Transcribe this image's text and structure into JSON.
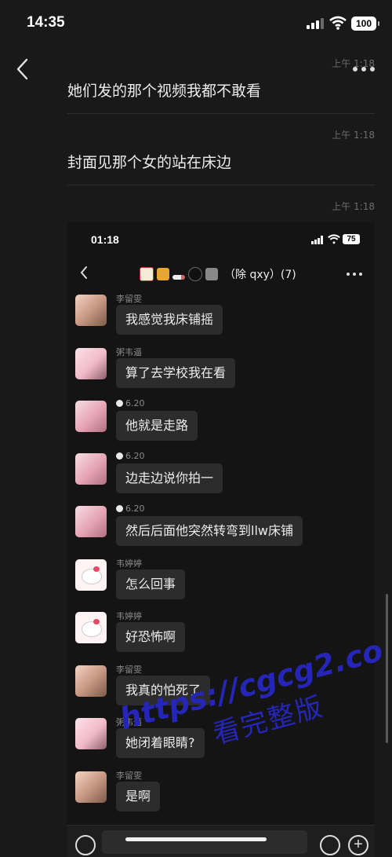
{
  "status_bar": {
    "time": "14:35",
    "battery": "100"
  },
  "messages": [
    {
      "timestamp": "上午 1:18",
      "text": "她们发的那个视频我都不敢看"
    },
    {
      "timestamp": "上午 1:18",
      "text": "封面见那个女的站在床边"
    },
    {
      "timestamp": "上午 1:18",
      "text": ""
    }
  ],
  "screenshot": {
    "status_bar": {
      "time": "01:18",
      "battery": "75"
    },
    "group_title": "（除 qxy）(7)",
    "title_emojis": [
      "mahjong-tile",
      "beer",
      "cigarette",
      "8-ball",
      "camera"
    ],
    "chat": [
      {
        "sender": "李留雯",
        "text": "我感觉我床铺摇",
        "avatar": "girl"
      },
      {
        "sender": "粥韦逼",
        "text": "算了去学校我在看",
        "avatar": "girl2"
      },
      {
        "sender": "6.20",
        "text": "他就是走路",
        "avatar": "pink"
      },
      {
        "sender": "6.20",
        "text": "边走边说你拍一",
        "avatar": "pink"
      },
      {
        "sender": "6.20",
        "text": "然后后面他突然转弯到llw床铺",
        "avatar": "pink"
      },
      {
        "sender": "韦婷婷",
        "text": "怎么回事",
        "avatar": "kitty"
      },
      {
        "sender": "韦婷婷",
        "text": "好恐怖啊",
        "avatar": "kitty"
      },
      {
        "sender": "李留雯",
        "text": "我真的怕死了",
        "avatar": "girl"
      },
      {
        "sender": "粥韦逼",
        "text": "她闭着眼睛?",
        "avatar": "girl2"
      },
      {
        "sender": "李留雯",
        "text": "是啊",
        "avatar": "girl"
      }
    ]
  },
  "watermark": {
    "url": "https://cgcg2.co",
    "subtitle": "看完整版"
  },
  "colors": {
    "background": "#191919",
    "bubble": "#2c2c2c",
    "watermark": "#2525b8"
  }
}
